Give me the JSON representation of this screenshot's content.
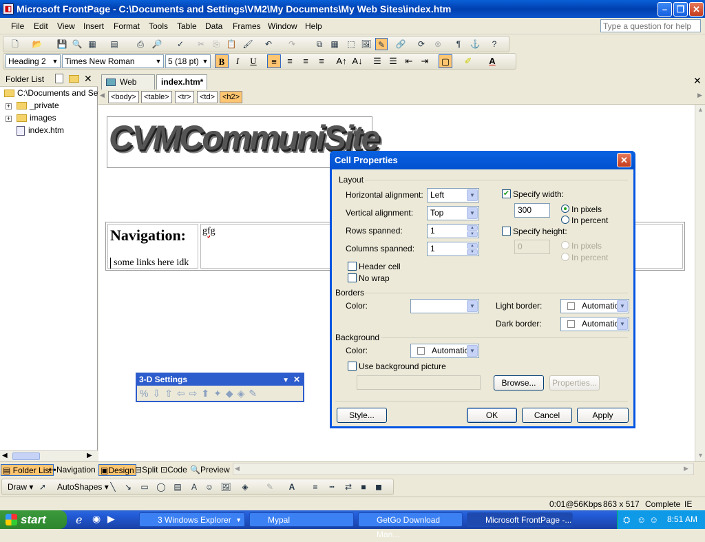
{
  "title": "Microsoft FrontPage - C:\\Documents and Settings\\VM2\\My Documents\\My Web Sites\\index.htm",
  "menu": [
    "File",
    "Edit",
    "View",
    "Insert",
    "Format",
    "Tools",
    "Table",
    "Data",
    "Frames",
    "Window",
    "Help"
  ],
  "help_placeholder": "Type a question for help",
  "format": {
    "style": "Heading 2",
    "font": "Times New Roman",
    "size": "5  (18 pt)"
  },
  "folder_list": {
    "title": "Folder List",
    "root": "C:\\Documents and Setti",
    "items": [
      "_private",
      "images",
      "index.htm"
    ]
  },
  "tabs": [
    "Web Site",
    "index.htm*"
  ],
  "tags": [
    "<body>",
    "<table>",
    "<tr>",
    "<td>",
    "<h2>"
  ],
  "page": {
    "logo": "CVMCommuniSite",
    "nav_heading": "Navigation:",
    "nav_text": "some links here idk",
    "cell_text": "gfg"
  },
  "view_tabs": [
    "Folder List",
    "Navigation",
    "Design",
    "Split",
    "Code",
    "Preview"
  ],
  "draw_toolbar": {
    "draw": "Draw",
    "autoshapes": "AutoShapes"
  },
  "status": {
    "speed": "0:01@56Kbps",
    "size": "863 x 517",
    "state": "Complete",
    "mode": "IE"
  },
  "three_d": {
    "title": "3-D Settings"
  },
  "dialog": {
    "title": "Cell Properties",
    "layout_group": "Layout",
    "h_align_label": "Horizontal alignment:",
    "h_align": "Left",
    "v_align_label": "Vertical alignment:",
    "v_align": "Top",
    "rows_label": "Rows spanned:",
    "rows": "1",
    "cols_label": "Columns spanned:",
    "cols": "1",
    "header_cell": "Header cell",
    "no_wrap": "No wrap",
    "spec_width": "Specify width:",
    "width_value": "300",
    "in_pixels": "In pixels",
    "in_percent": "In percent",
    "spec_height": "Specify height:",
    "height_value": "0",
    "borders_group": "Borders",
    "color_label": "Color:",
    "light_border": "Light border:",
    "dark_border": "Dark border:",
    "automatic": "Automatic",
    "background_group": "Background",
    "use_bg": "Use background picture",
    "browse": "Browse...",
    "properties": "Properties...",
    "style": "Style...",
    "ok": "OK",
    "cancel": "Cancel",
    "apply": "Apply"
  },
  "taskbar": {
    "start": "start",
    "tasks": [
      "3 Windows Explorer",
      "Mypal",
      "GetGo Download Man...",
      "Microsoft FrontPage -..."
    ],
    "clock": "8:51 AM"
  }
}
